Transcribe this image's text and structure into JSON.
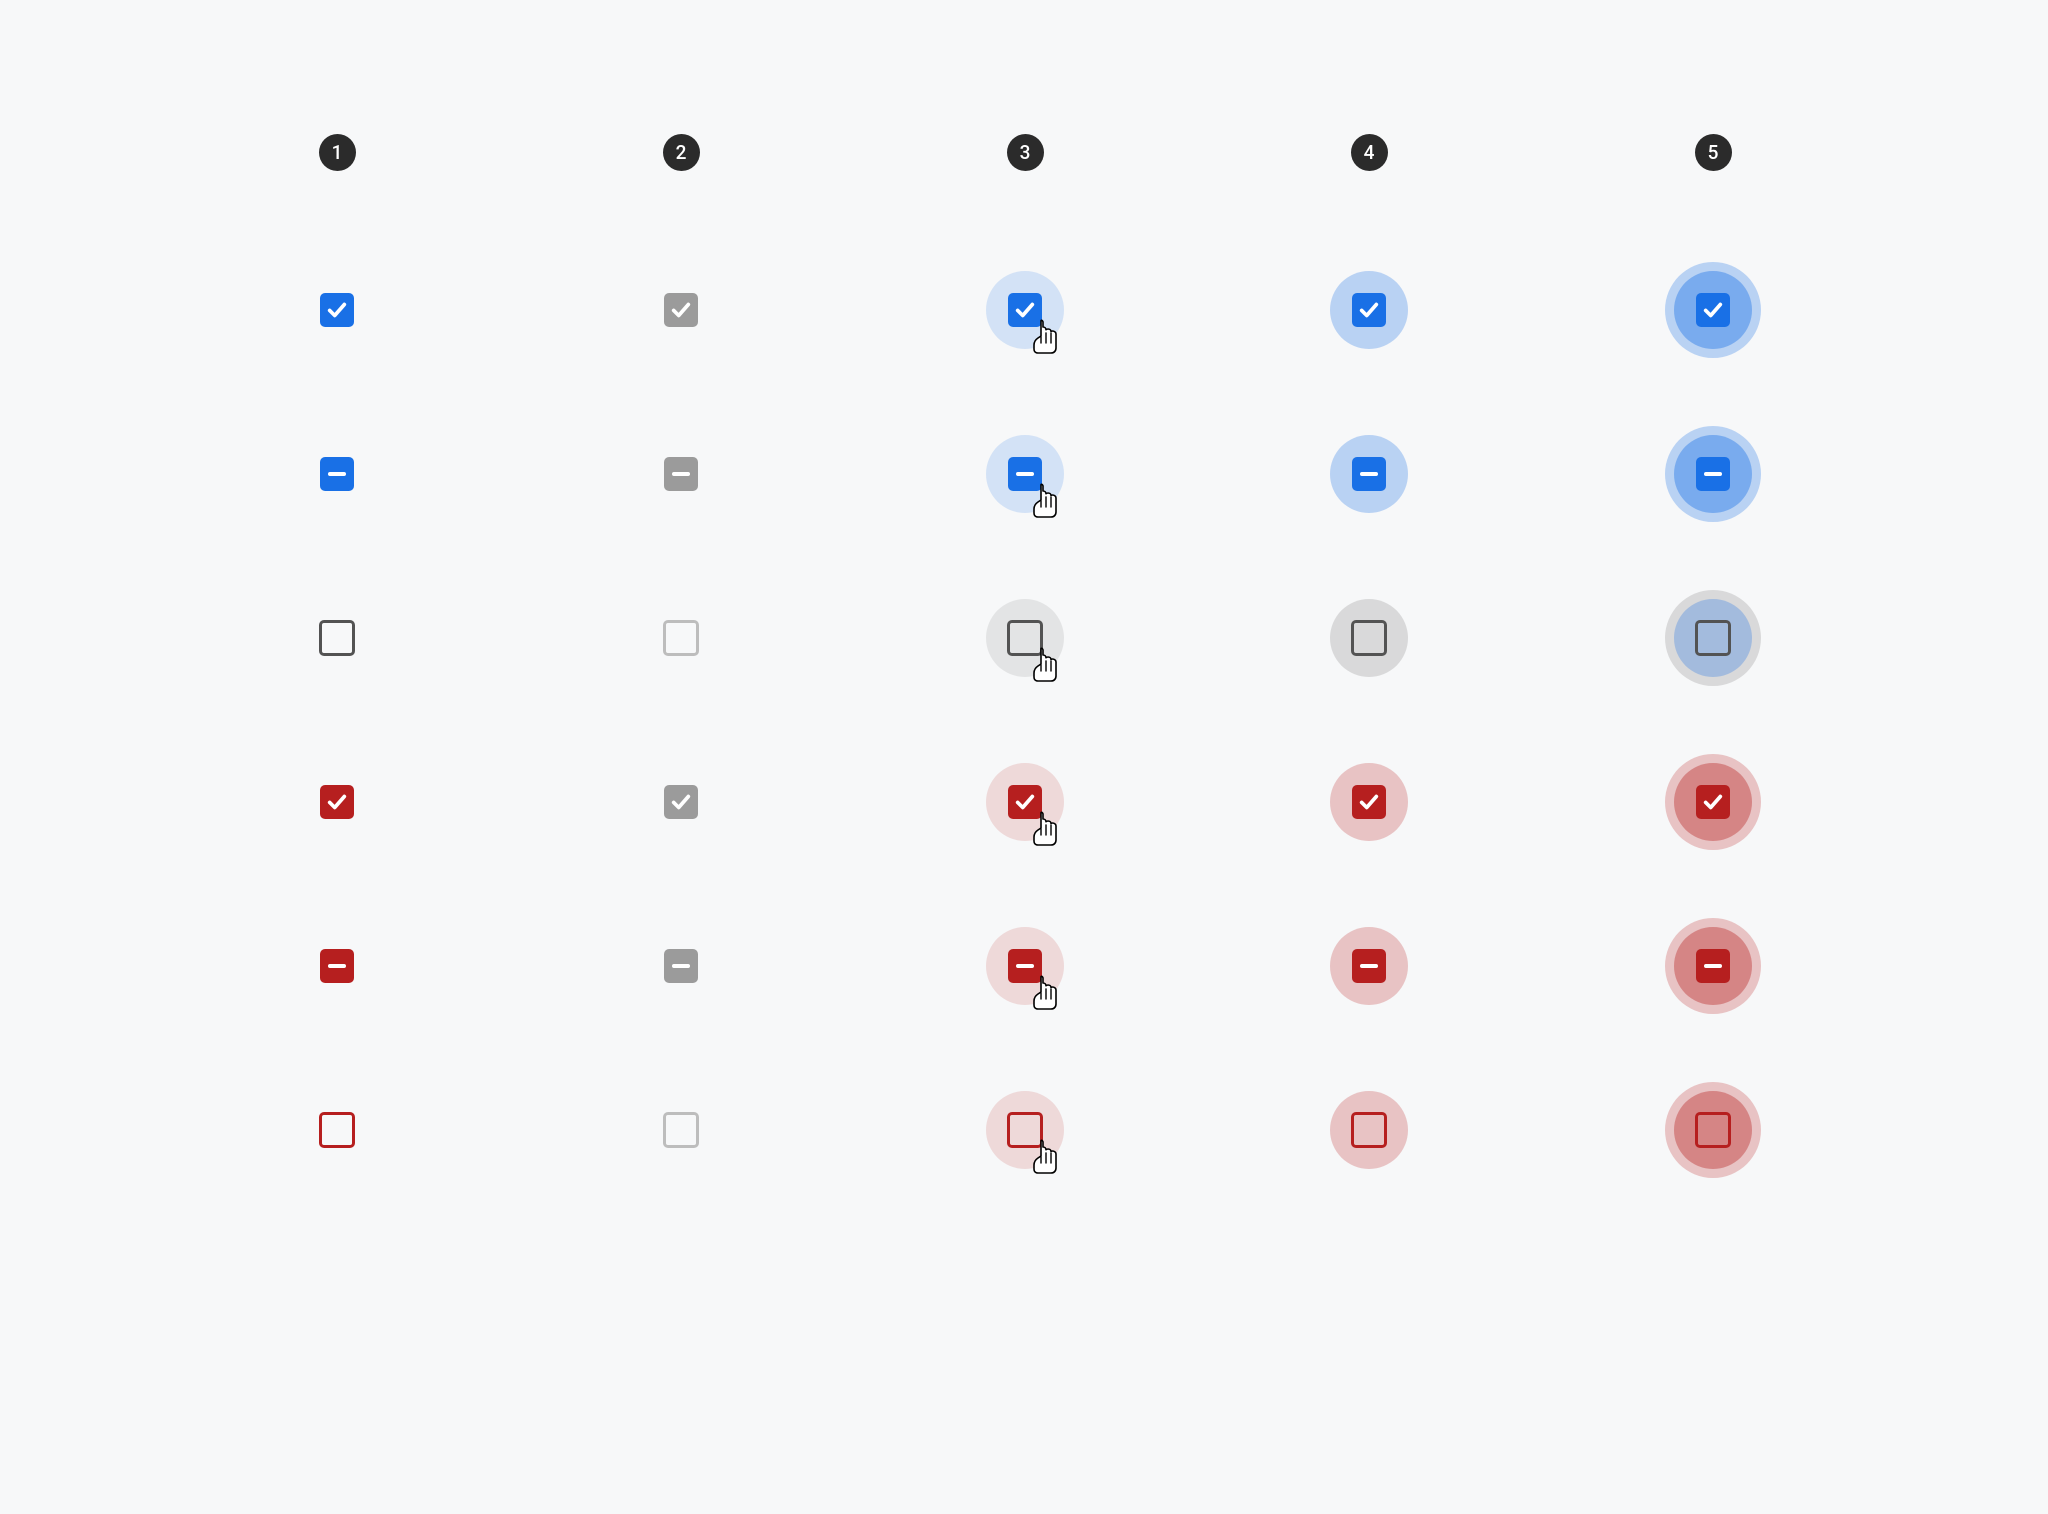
{
  "columns": [
    "1",
    "2",
    "3",
    "4",
    "5"
  ],
  "palettes": {
    "primary": {
      "fill": "#1970E6",
      "outline": "#535353",
      "halo_light": "rgba(25,112,230,0.16)",
      "halo_mid": "rgba(25,112,230,0.28)",
      "halo_dark": "rgba(25,112,230,0.40)",
      "empty_halo_light": "rgba(0,0,0,0.08)",
      "empty_halo_mid": "rgba(0,0,0,0.12)"
    },
    "error": {
      "fill": "#B61F1F",
      "outline": "#B61F1F",
      "halo_light": "rgba(182,31,31,0.14)",
      "halo_mid": "rgba(182,31,31,0.24)",
      "halo_dark": "rgba(182,31,31,0.38)"
    },
    "disabled": {
      "fill": "#9B9B9B",
      "outline": "#BDBDBD"
    }
  },
  "rows": [
    {
      "state": "checked",
      "palette": "primary"
    },
    {
      "state": "indeterminate",
      "palette": "primary"
    },
    {
      "state": "unchecked",
      "palette": "primary"
    },
    {
      "state": "checked",
      "palette": "error"
    },
    {
      "state": "indeterminate",
      "palette": "error"
    },
    {
      "state": "unchecked",
      "palette": "error"
    }
  ],
  "column_variants": [
    {
      "variant": "enabled",
      "halo": "none",
      "cursor": false,
      "interactable": true
    },
    {
      "variant": "disabled",
      "halo": "none",
      "cursor": false,
      "interactable": false
    },
    {
      "variant": "hover",
      "halo": "light",
      "cursor": true,
      "interactable": true
    },
    {
      "variant": "focus",
      "halo": "mid",
      "cursor": false,
      "interactable": true
    },
    {
      "variant": "pressed",
      "halo": "dark",
      "cursor": false,
      "interactable": true
    }
  ]
}
